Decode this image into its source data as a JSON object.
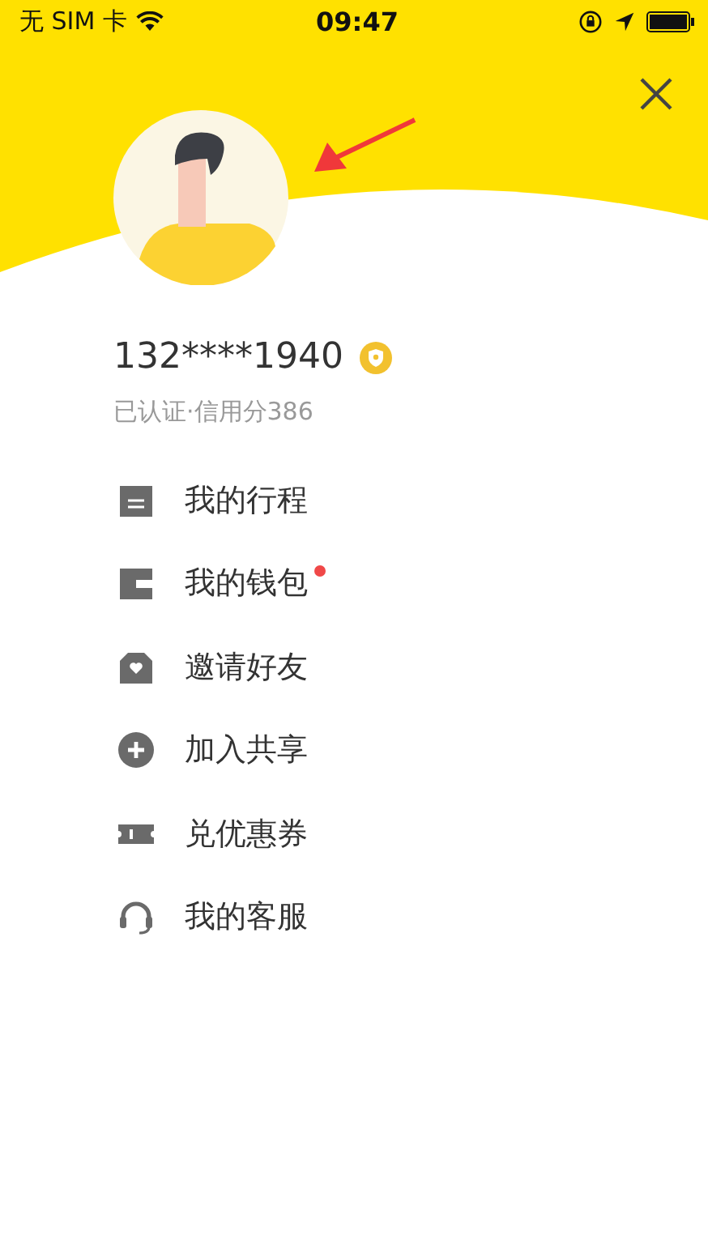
{
  "status_bar": {
    "carrier": "无 SIM 卡",
    "time": "09:47"
  },
  "profile": {
    "phone": "132****1940",
    "subtitle": "已认证·信用分386"
  },
  "menu": [
    {
      "kind": "trips",
      "label": "我的行程",
      "badge": false
    },
    {
      "kind": "wallet",
      "label": "我的钱包",
      "badge": true
    },
    {
      "kind": "invite",
      "label": "邀请好友",
      "badge": false
    },
    {
      "kind": "share",
      "label": "加入共享",
      "badge": false
    },
    {
      "kind": "coupon",
      "label": "兑优惠券",
      "badge": false
    },
    {
      "kind": "service",
      "label": "我的客服",
      "badge": false
    }
  ]
}
